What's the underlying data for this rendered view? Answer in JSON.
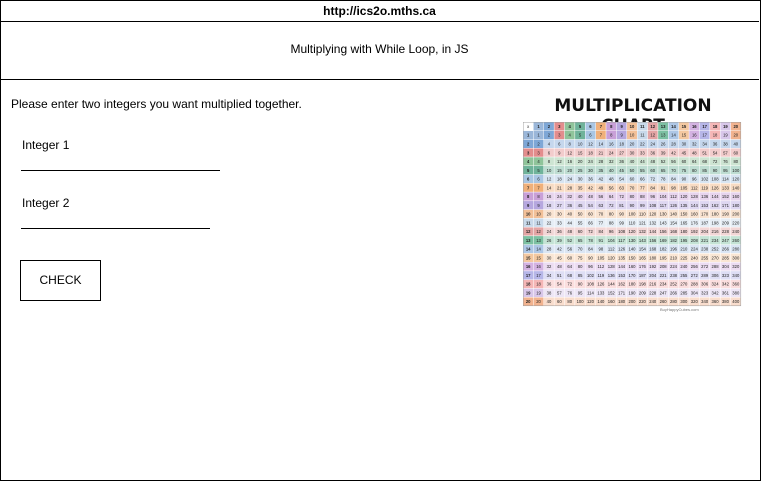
{
  "browser": {
    "url": "http://ics2o.mths.ca"
  },
  "header": {
    "title": "Multiplying with While Loop, in JS"
  },
  "form": {
    "instructions": "Please enter two integers you want multiplied together.",
    "integer1_label": "Integer 1",
    "integer2_label": "Integer 2",
    "check_label": "CHECK"
  },
  "chart": {
    "title": "MULTIPLICATION CHART",
    "corner_label": "x",
    "size": 20,
    "colors": {
      "1": "#9bb7d9",
      "2": "#7ea7d6",
      "3": "#e38d8d",
      "4": "#8fc49a",
      "5": "#6fb39a",
      "6": "#a9c6e3",
      "7": "#f0b07a",
      "8": "#c9a0d8",
      "9": "#b6a7df",
      "10": "#f2c098",
      "11": "#c8d9ea",
      "12": "#e3a4a4",
      "13": "#7cc0a2",
      "14": "#aec7e6",
      "15": "#f4c8a0",
      "16": "#d4b2e2",
      "17": "#b6b6e8",
      "18": "#f5b6b6",
      "19": "#d8c7ea",
      "20": "#f2b38f"
    },
    "credit": "BuyHappyCubes.com"
  }
}
